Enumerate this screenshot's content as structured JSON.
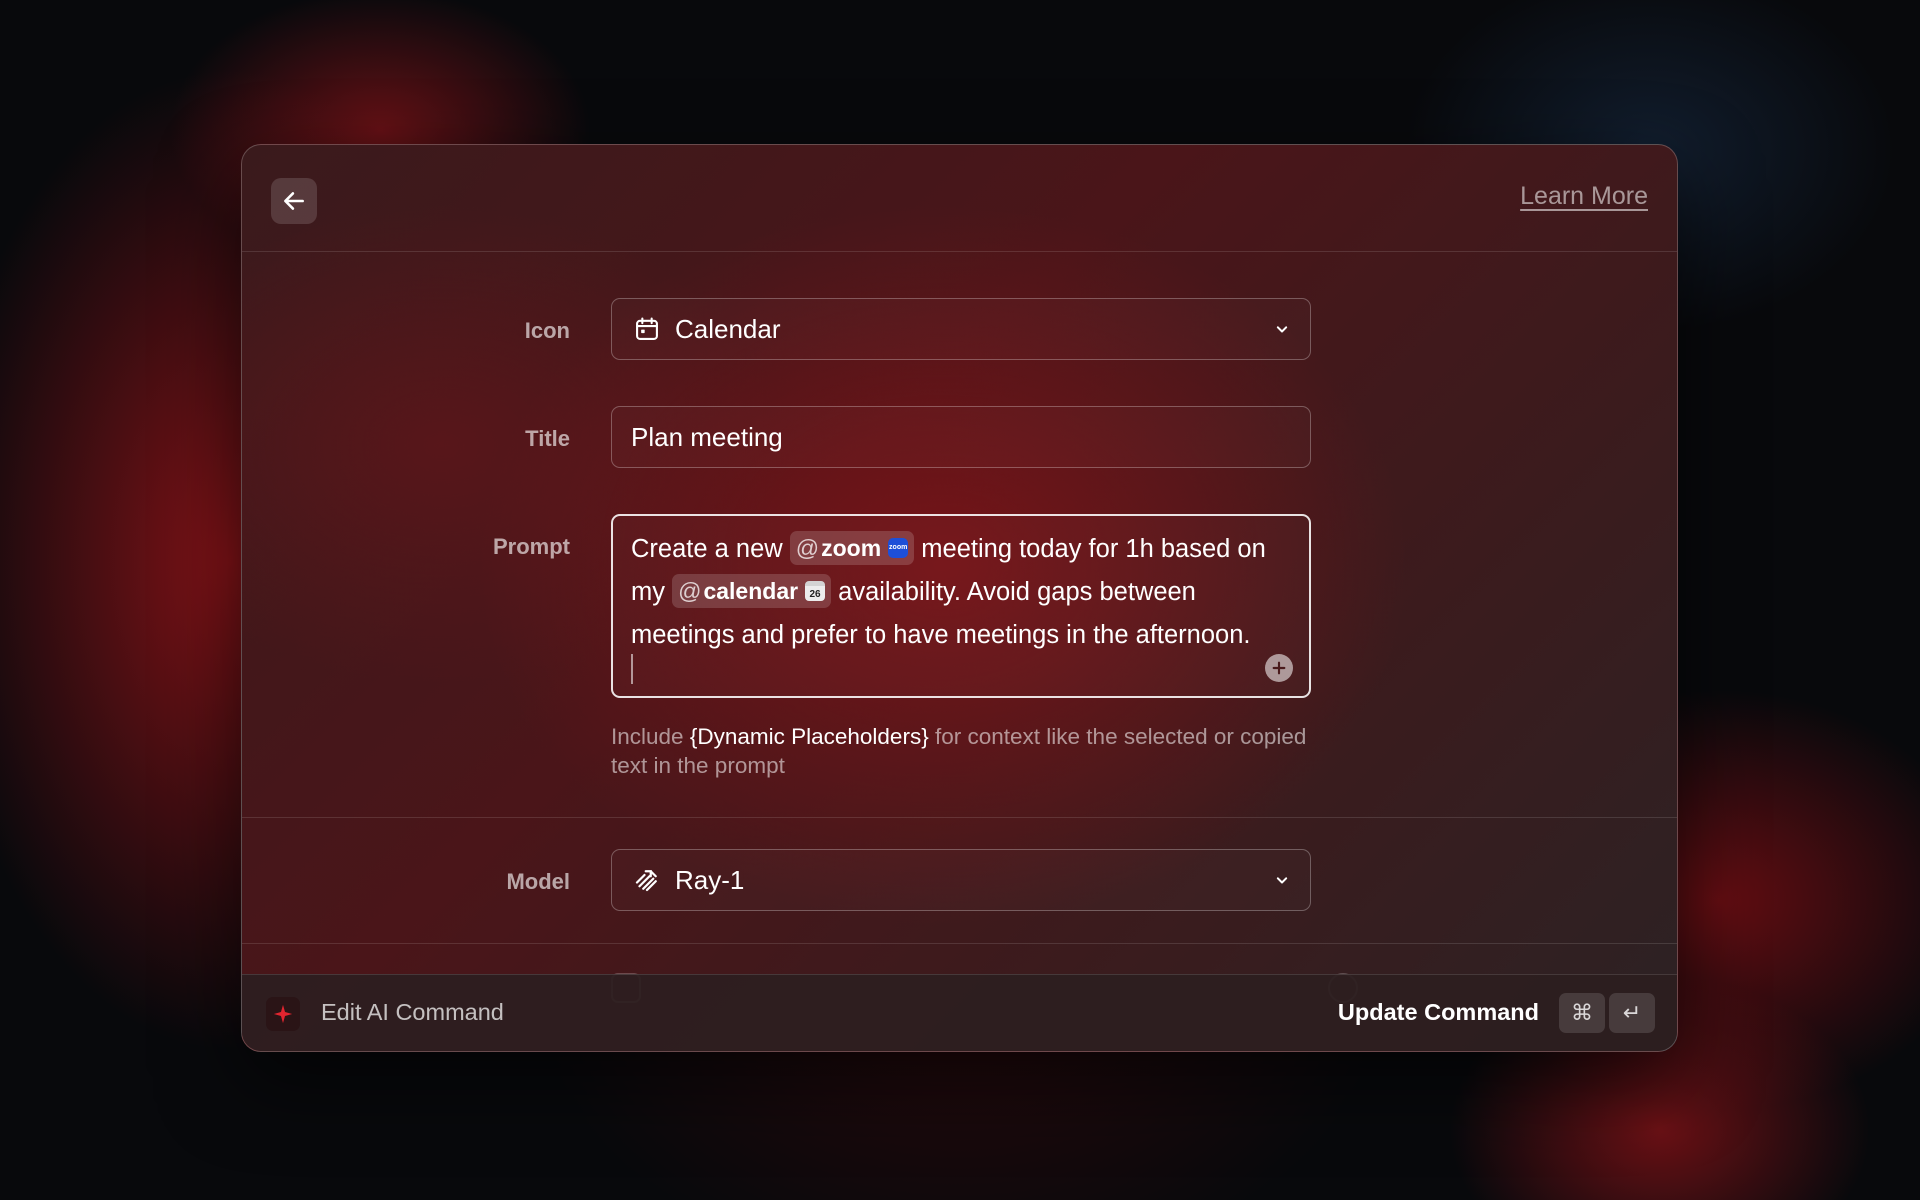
{
  "header": {
    "back_icon": "arrow-left-icon",
    "learn_more": "Learn More"
  },
  "form": {
    "icon": {
      "label": "Icon",
      "value": "Calendar",
      "icon": "calendar-icon"
    },
    "title": {
      "label": "Title",
      "value": "Plan meeting"
    },
    "prompt": {
      "label": "Prompt",
      "text_1": "Create a new",
      "mention_1": "zoom",
      "mention_1_at": "@",
      "mention_1_logo": "zoom",
      "text_2": "meeting today for 1h based on my",
      "mention_2": "calendar",
      "mention_2_at": "@",
      "mention_2_logo": "26",
      "text_3": "availability. Avoid gaps between meetings and prefer to have meetings in the afternoon."
    },
    "hint": {
      "before": "Include",
      "highlight": "{Dynamic Placeholders}",
      "after": "for context like the selected or copied text in the prompt"
    },
    "model": {
      "label": "Model",
      "value": "Ray-1",
      "icon": "ray-model-icon"
    }
  },
  "footer": {
    "icon": "sparkle-icon",
    "title": "Edit AI Command",
    "action": "Update Command",
    "shortcut_cmd": "⌘",
    "shortcut_enter": "↵"
  },
  "colors": {
    "accent": "#e2252f",
    "window_bg": "#4a1519",
    "footer_bg": "#2d1e20"
  }
}
